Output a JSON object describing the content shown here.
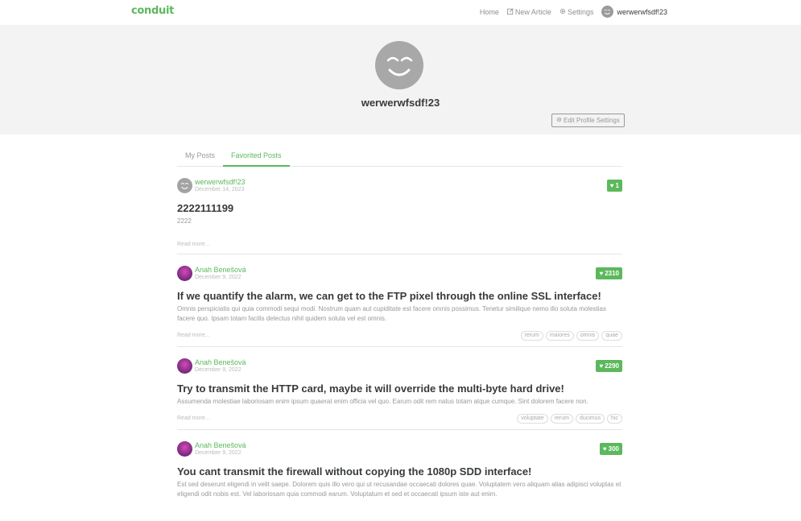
{
  "nav": {
    "brand": "conduit",
    "home": "Home",
    "new_article": "New Article",
    "settings": "Settings",
    "username": "werwerwfsdf!23",
    "icons": {
      "new_article": "edit-icon",
      "settings": "gear-icon"
    }
  },
  "profile": {
    "username": "werwerwfsdf!23",
    "edit_button": "Edit Profile Settings"
  },
  "tabs": [
    {
      "label": "My Posts",
      "active": false
    },
    {
      "label": "Favorited Posts",
      "active": true
    }
  ],
  "articles": [
    {
      "author": "werwerwfsdf!23",
      "date": "December 14, 2023",
      "favorites": "1",
      "title": "2222111199",
      "description": "2222",
      "read_more": "Read more...",
      "tags": []
    },
    {
      "author": "Anah Benešová",
      "date": "December 9, 2022",
      "favorites": "2310",
      "title": "If we quantify the alarm, we can get to the FTP pixel through the online SSL interface!",
      "description": "Omnis perspiciatis qui quia commodi sequi modi. Nostrum quam aut cupiditate est facere omnis possimus. Tenetur similique nemo illo soluta molestias facere quo. Ipsam totam facilis delectus nihil quidem soluta vel est omnis.",
      "read_more": "Read more...",
      "tags": [
        "rerum",
        "maiores",
        "omnis",
        "quae"
      ]
    },
    {
      "author": "Anah Benešová",
      "date": "December 9, 2022",
      "favorites": "2290",
      "title": "Try to transmit the HTTP card, maybe it will override the multi-byte hard drive!",
      "description": "Assumenda molestiae laboriosam enim ipsum quaerat enim officia vel quo. Earum odit rem natus totam atque cumque. Sint dolorem facere non.",
      "read_more": "Read more...",
      "tags": [
        "voluptate",
        "rerum",
        "ducimus",
        "hic"
      ]
    },
    {
      "author": "Anah Benešová",
      "date": "December 9, 2022",
      "favorites": "300",
      "title": "You cant transmit the firewall without copying the 1080p SDD interface!",
      "description": "Est sed deserunt eligendi in velit saepe. Dolorem quis illo vero qui ut recusandae occaecati dolores quae. Voluptatem vero aliquam alias adipisci voluptas et eligendi odit nobis est. Vel laboriosam quia commodi earum. Voluptatum et sed et occaecati ipsum iste aut enim.",
      "read_more": "Read more...",
      "tags": []
    }
  ],
  "colors": {
    "accent": "#5cb85c",
    "banner_bg": "#f3f3f3",
    "text": "#373a3c",
    "muted": "#999999"
  }
}
